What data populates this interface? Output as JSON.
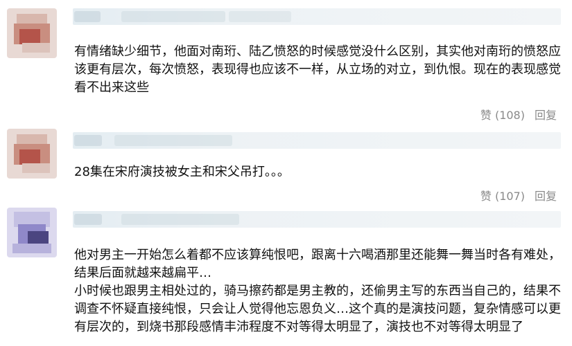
{
  "comments": [
    {
      "text": "有情绪缺少细节，他面对南珩、陆乙愤怒的时候感觉没什么区别，其实他对南珩的愤怒应该更有层次，每次愤怒，表现得也应该不一样，从立场的对立，到仇恨。现在的表现感觉看不出来这些",
      "like_label": "赞",
      "like_count": "(108)",
      "reply_label": "回复"
    },
    {
      "text": "28集在宋府演技被女主和宋父吊打。。。",
      "like_label": "赞",
      "like_count": "(107)",
      "reply_label": "回复"
    },
    {
      "text_line1": "他对男主一开始怎么着都不应该算纯恨吧，跟离十六喝酒那里还能舞一舞当时各有难处，结果后面就越来越扁平…",
      "text_line2": "小时候也跟男主相处过的，骑马擦药都是男主教的，还偷男主写的东西当自己的，结果不调查不怀疑直接纯恨，只会让人觉得他忘恩负义…这个真的是演技问题，复杂情感可以更有层次的，到烧书那段感情丰沛程度不对等得太明显了，演技也不对等得太明显了"
    }
  ],
  "icons": {
    "like": "thumbs-up-icon",
    "avatar": "blurred-avatar"
  }
}
